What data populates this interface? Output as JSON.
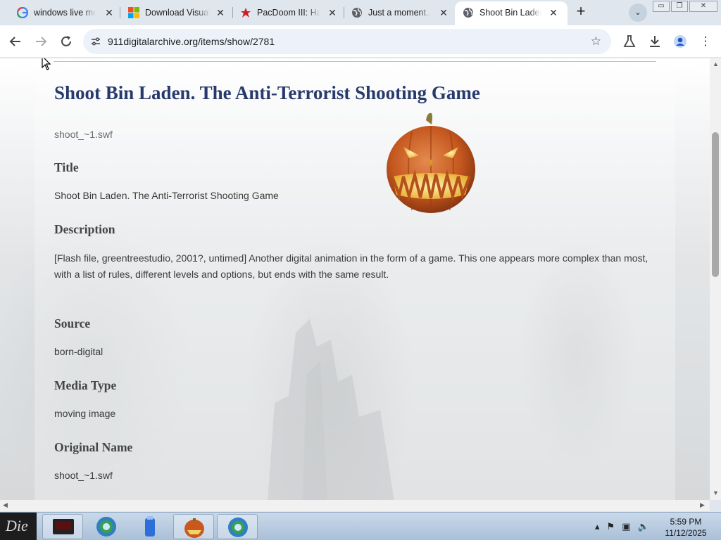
{
  "tabs": [
    {
      "title": "windows live me",
      "favicon": "google-icon"
    },
    {
      "title": "Download Visual",
      "favicon": "microsoft-icon"
    },
    {
      "title": "PacDoom III: Hal",
      "favicon": "pacdoom-icon"
    },
    {
      "title": "Just a moment...",
      "favicon": "globe-icon"
    },
    {
      "title": "Shoot Bin Laden",
      "favicon": "globe-icon",
      "active": true
    }
  ],
  "address_bar": {
    "url": "911digitalarchive.org/items/show/2781"
  },
  "page": {
    "title": "Shoot Bin Laden. The Anti-Terrorist Shooting Game",
    "file_link": "shoot_~1.swf",
    "fields": [
      {
        "label": "Title",
        "value": "Shoot Bin Laden. The Anti-Terrorist Shooting Game"
      },
      {
        "label": "Description",
        "value": "[Flash file, greentreestudio, 2001?, untimed] Another digital animation in the form of a game. This one appears more complex than most, with a list of rules, different levels and options, but ends with the same result."
      },
      {
        "label": "Source",
        "value": "born-digital"
      },
      {
        "label": "Media Type",
        "value": "moving image"
      },
      {
        "label": "Original Name",
        "value": "shoot_~1.swf"
      }
    ]
  },
  "taskbar": {
    "start_label": "Die",
    "clock": {
      "time": "5:59 PM",
      "date": "11/12/2025"
    }
  },
  "colors": {
    "title": "#273a6b",
    "tab_strip": "#dfe6ee",
    "omnibox": "#edf2fa"
  }
}
